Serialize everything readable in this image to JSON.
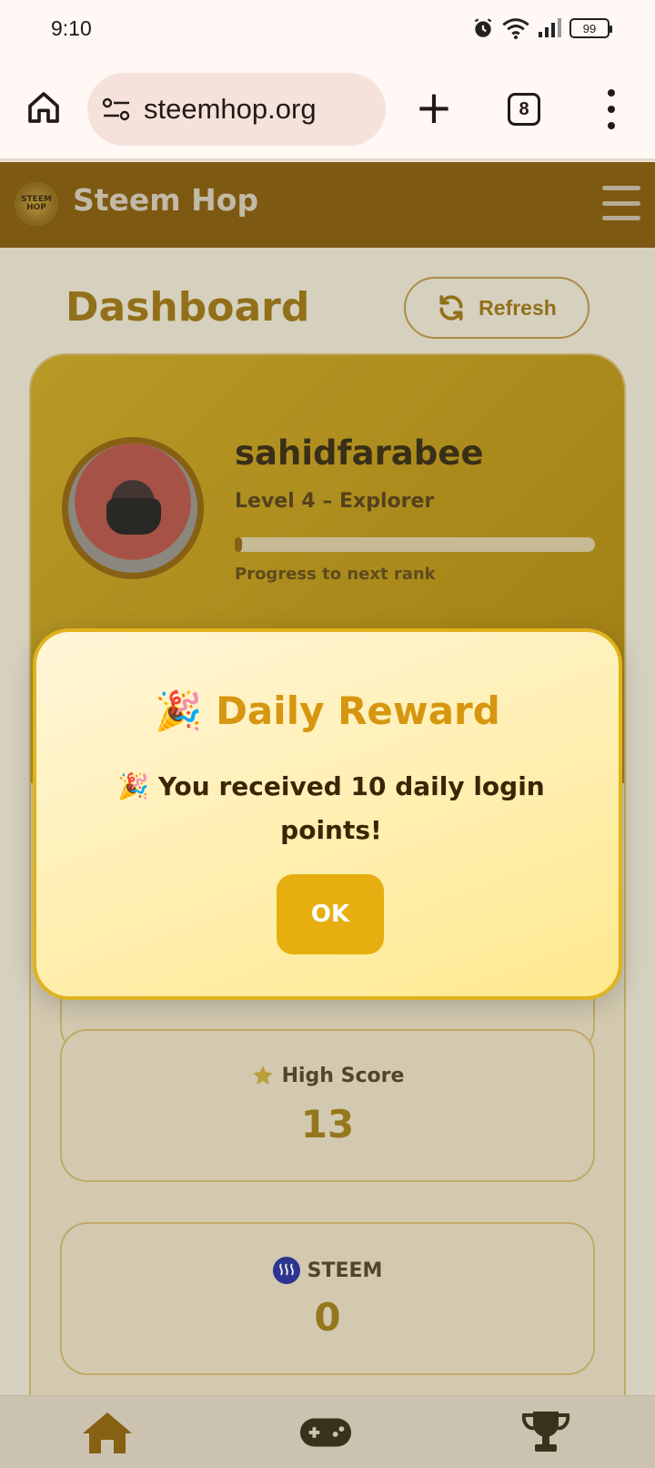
{
  "status_bar": {
    "time": "9:10",
    "battery": "99"
  },
  "browser": {
    "url": "steemhop.org",
    "tab_count": "8"
  },
  "app": {
    "title": "Steem Hop",
    "logo_text": "STEEM HOP"
  },
  "dashboard": {
    "title": "Dashboard",
    "refresh_label": "Refresh",
    "profile": {
      "username": "sahidfarabee",
      "level": "Level 4 – Explorer",
      "progress_fraction": 0.02,
      "progress_label": "Progress to next rank"
    },
    "stats": [
      {
        "label": "High Score",
        "value": "13",
        "icon": "star-icon"
      },
      {
        "label": "STEEM",
        "value": "0",
        "icon": "steem-icon"
      }
    ]
  },
  "modal": {
    "title": "🎉 Daily Reward",
    "message": "🎉 You received 10 daily login points!",
    "ok_label": "OK"
  },
  "bottom_nav": [
    {
      "icon": "home-icon"
    },
    {
      "icon": "gamepad-icon"
    },
    {
      "icon": "trophy-icon"
    }
  ],
  "colors": {
    "brand": "#7f5505",
    "accent": "#e6ae0e",
    "title_gold": "#d6960f"
  }
}
